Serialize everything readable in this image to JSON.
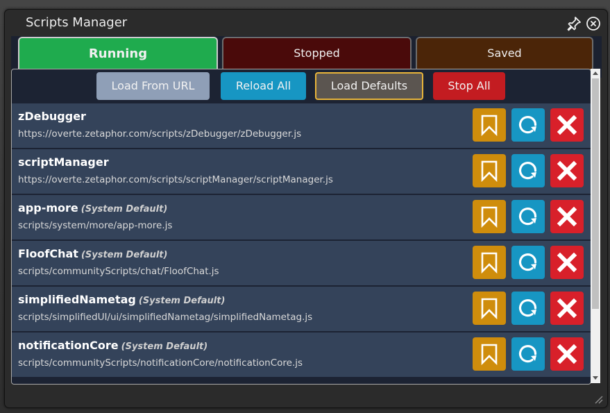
{
  "window": {
    "title": "Scripts Manager",
    "pin_icon": "pin-icon",
    "close_icon": "close-circle-icon"
  },
  "tabs": [
    {
      "label": "Running",
      "active": true,
      "color": "#1fab4e"
    },
    {
      "label": "Stopped",
      "active": false,
      "color": "#4a0a0a"
    },
    {
      "label": "Saved",
      "active": false,
      "color": "#4b2508"
    }
  ],
  "actions": {
    "load_url": "Load From URL",
    "reload_all": "Reload All",
    "load_defaults": "Load Defaults",
    "stop_all": "Stop All"
  },
  "scripts": [
    {
      "name": "zDebugger",
      "tag": "",
      "path": "https://overte.zetaphor.com/scripts/zDebugger/zDebugger.js"
    },
    {
      "name": "scriptManager",
      "tag": "",
      "path": "https://overte.zetaphor.com/scripts/scriptManager/scriptManager.js"
    },
    {
      "name": "app-more",
      "tag": "(System Default)",
      "path": "scripts/system/more/app-more.js"
    },
    {
      "name": "FloofChat",
      "tag": "(System Default)",
      "path": "scripts/communityScripts/chat/FloofChat.js"
    },
    {
      "name": "simplifiedNametag",
      "tag": "(System Default)",
      "path": "scripts/simplifiedUI/ui/simplifiedNametag/simplifiedNametag.js"
    },
    {
      "name": "notificationCore",
      "tag": "(System Default)",
      "path": "scripts/communityScripts/notificationCore/notificationCore.js"
    }
  ],
  "row_icons": {
    "save": "bookmark-icon",
    "reload": "reload-icon",
    "stop": "x-icon"
  },
  "colors": {
    "save": "#cf8d0c",
    "reload": "#1796c3",
    "stop": "#d8202a",
    "row_bg": "#34435a"
  }
}
